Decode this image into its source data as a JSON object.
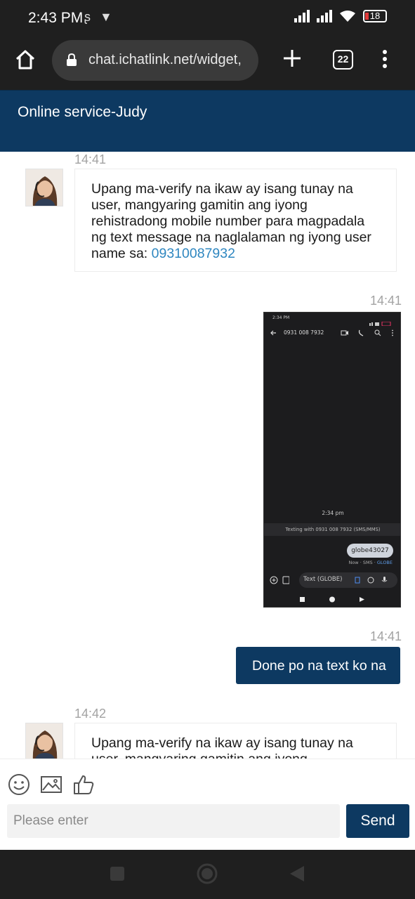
{
  "statusbar": {
    "time": "2:43 PM",
    "left_icons": "ʂ ▼",
    "battery": "18"
  },
  "browser": {
    "url": "chat.ichatlink.net/widget,",
    "tab_count": "22"
  },
  "chat": {
    "title": "Online service-Judy",
    "messages": [
      {
        "time": "14:41",
        "text": "Upang ma-verify na ikaw ay isang tunay na user, mangyaring gamitin ang iyong rehistradong mobile number para magpadala ng text message na naglalaman ng iyong user name sa: ",
        "link": "09310087932"
      },
      {
        "time": "14:41",
        "screenshot": {
          "time": "2:34 PM",
          "contact": "0931 008 7932",
          "msg_time": "2:34 pm",
          "texting_with": "Texting with 0931 008 7932 (SMS/MMS)",
          "bubble": "globe43027",
          "meta": "Now · SMS · ",
          "meta_carrier": "GLOBE",
          "input_placeholder": "Text (GLOBE)"
        }
      },
      {
        "time": "14:41",
        "text": "Done po na text ko na"
      },
      {
        "time": "14:42",
        "text": "Upang ma-verify na ikaw ay isang tunay na user, mangyaring gamitin ang iyong"
      }
    ]
  },
  "input": {
    "placeholder": "Please enter",
    "send_label": "Send"
  },
  "icons": {
    "home": "home-icon",
    "lock": "lock-icon",
    "new_tab": "plus-icon",
    "menu": "kebab-menu-icon",
    "emoji": "smiley-icon",
    "image": "image-icon",
    "like": "thumbs-up-icon",
    "nav_recent": "square-icon",
    "nav_home": "circle-icon",
    "nav_back": "triangle-back-icon"
  },
  "colors": {
    "brand": "#0d3961",
    "link": "#2f87c0",
    "timestamp": "#a3a3a3"
  }
}
